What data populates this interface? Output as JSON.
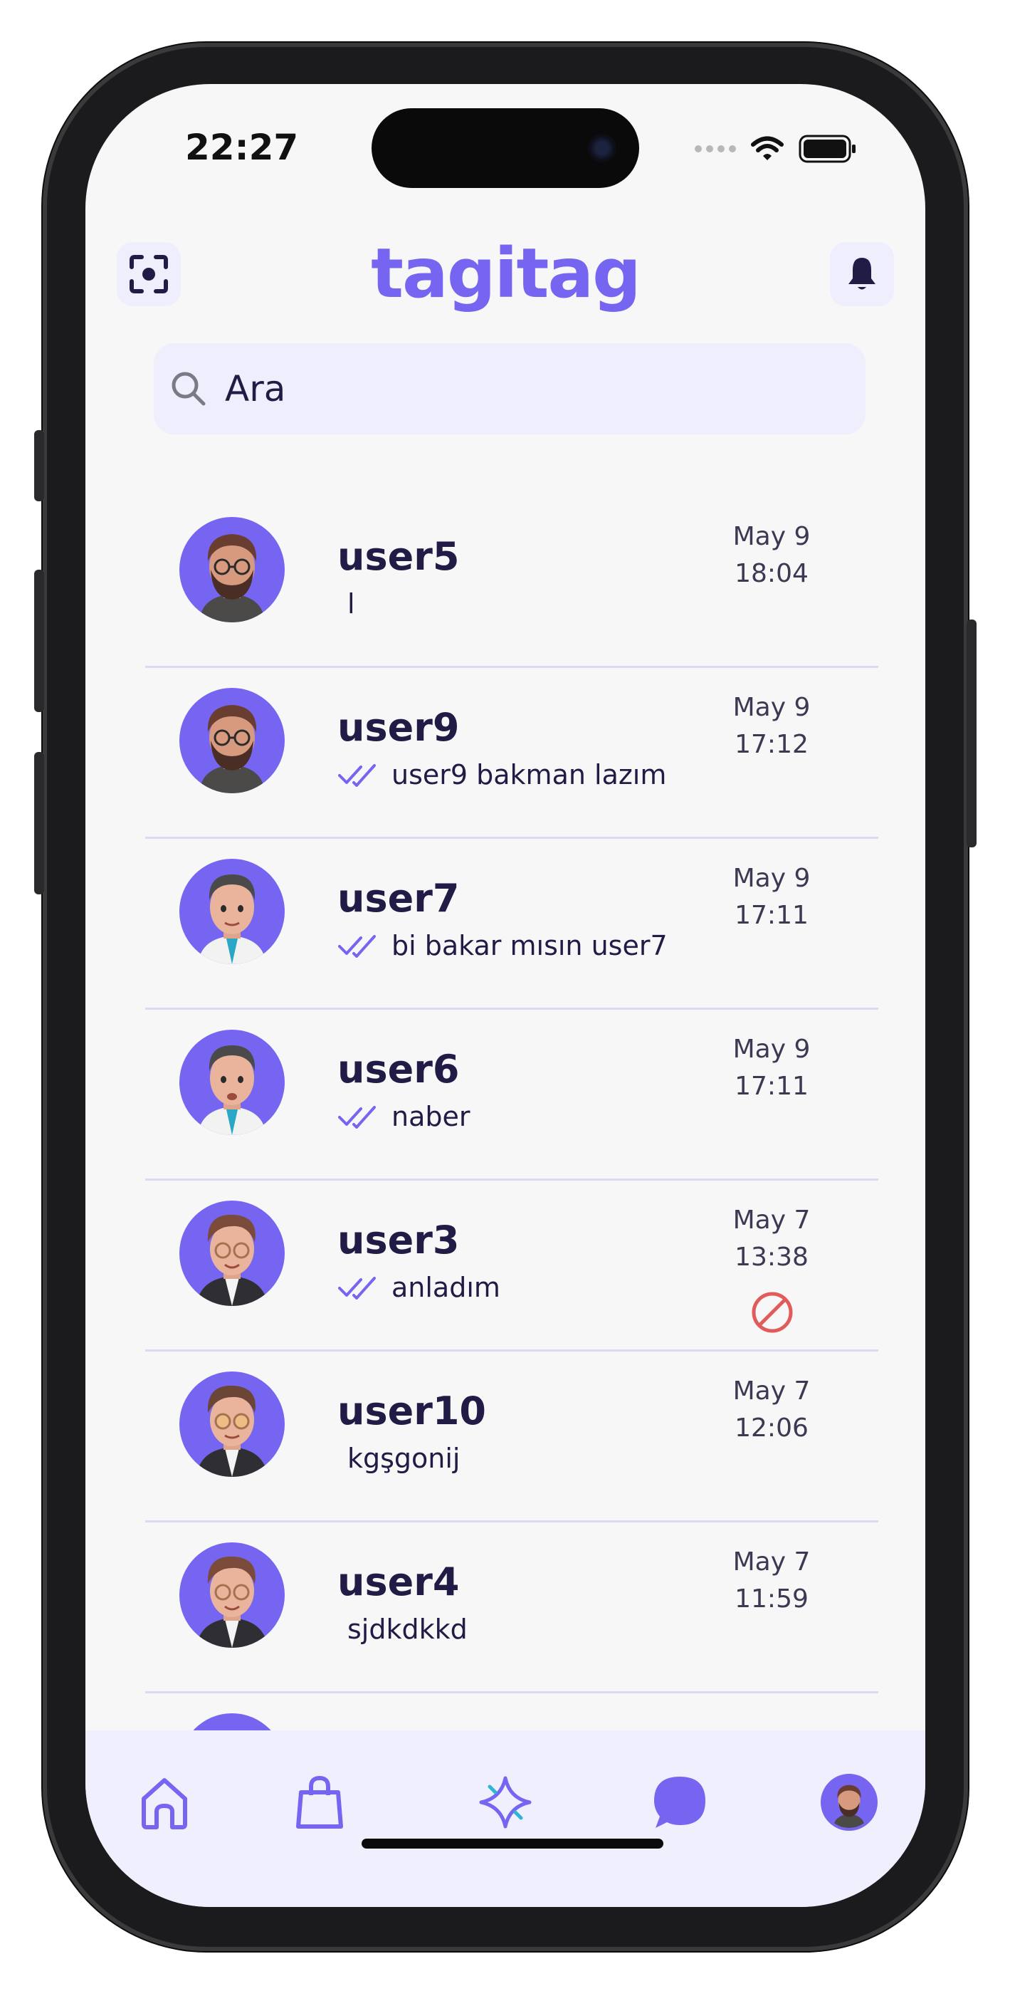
{
  "status_bar": {
    "time": "22:27"
  },
  "header": {
    "brand": "tagitag"
  },
  "search": {
    "placeholder": "Ara"
  },
  "chats": [
    {
      "name": "user5",
      "message": "l",
      "read": false,
      "date": "May 9",
      "time": "18:04",
      "blocked": false
    },
    {
      "name": "user9",
      "message": "user9 bakman lazım",
      "read": true,
      "date": "May 9",
      "time": "17:12",
      "blocked": false
    },
    {
      "name": "user7",
      "message": "bi bakar mısın user7",
      "read": true,
      "date": "May 9",
      "time": "17:11",
      "blocked": false
    },
    {
      "name": "user6",
      "message": "naber",
      "read": true,
      "date": "May 9",
      "time": "17:11",
      "blocked": false
    },
    {
      "name": "user3",
      "message": "anladım",
      "read": true,
      "date": "May 7",
      "time": "13:38",
      "blocked": true
    },
    {
      "name": "user10",
      "message": "kgşgonij",
      "read": false,
      "date": "May 7",
      "time": "12:06",
      "blocked": false
    },
    {
      "name": "user4",
      "message": "sjdkdkkd",
      "read": false,
      "date": "May 7",
      "time": "11:59",
      "blocked": false
    }
  ],
  "tabs": [
    "home-icon",
    "shopping-bag-icon",
    "sparkle-icon",
    "chat-bubble-icon",
    "profile-avatar"
  ],
  "colors": {
    "accent": "#7565f1",
    "dark_text": "#201c45",
    "danger": "#e25b5b"
  }
}
